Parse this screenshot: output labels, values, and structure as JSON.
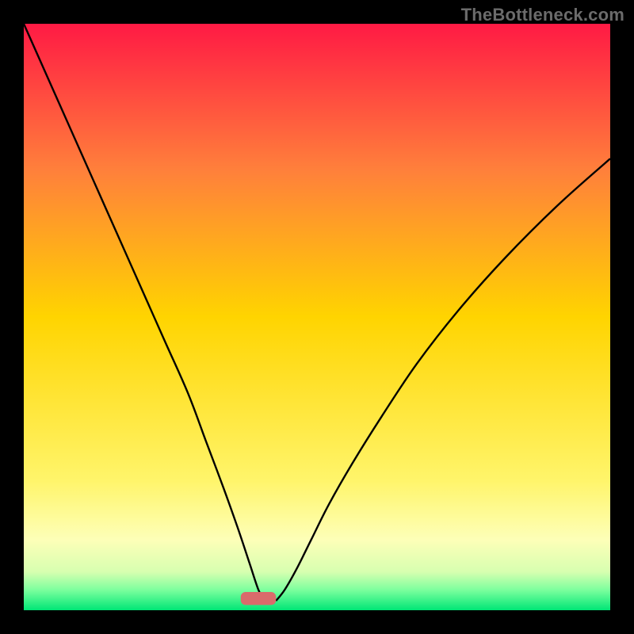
{
  "watermark": "TheBottleneck.com",
  "chart_data": {
    "type": "line",
    "title": "",
    "xlabel": "",
    "ylabel": "",
    "xlim": [
      0,
      100
    ],
    "ylim": [
      0,
      100
    ],
    "grid": false,
    "legend": false,
    "background_gradient_stops": [
      {
        "offset": 0.0,
        "color": "#ff1a44"
      },
      {
        "offset": 0.25,
        "color": "#ff803b"
      },
      {
        "offset": 0.5,
        "color": "#ffd400"
      },
      {
        "offset": 0.78,
        "color": "#fff56b"
      },
      {
        "offset": 0.88,
        "color": "#fdffb8"
      },
      {
        "offset": 0.935,
        "color": "#d7ffb0"
      },
      {
        "offset": 0.965,
        "color": "#7dff9e"
      },
      {
        "offset": 1.0,
        "color": "#00e676"
      }
    ],
    "marker": {
      "x": 40,
      "y": 2,
      "width": 6,
      "height": 2.2,
      "color": "#d96b6b",
      "shape": "rounded-rect"
    },
    "series": [
      {
        "name": "left-curve",
        "x": [
          0,
          4,
          8,
          12,
          16,
          20,
          24,
          28,
          31,
          34,
          36.5,
          38.5,
          40,
          41
        ],
        "y": [
          100,
          91,
          82,
          73,
          64,
          55,
          46,
          37,
          29,
          21,
          14,
          8,
          3.5,
          1.6
        ]
      },
      {
        "name": "right-curve",
        "x": [
          43,
          44.5,
          46.5,
          49,
          52,
          56,
          61,
          67,
          74,
          82,
          91,
          100
        ],
        "y": [
          1.6,
          3.5,
          7,
          12,
          18,
          25,
          33,
          42,
          51,
          60,
          69,
          77
        ]
      }
    ],
    "notes": "y-values are percent of plot height from bottom; curves converge toward marker near x≈40."
  }
}
